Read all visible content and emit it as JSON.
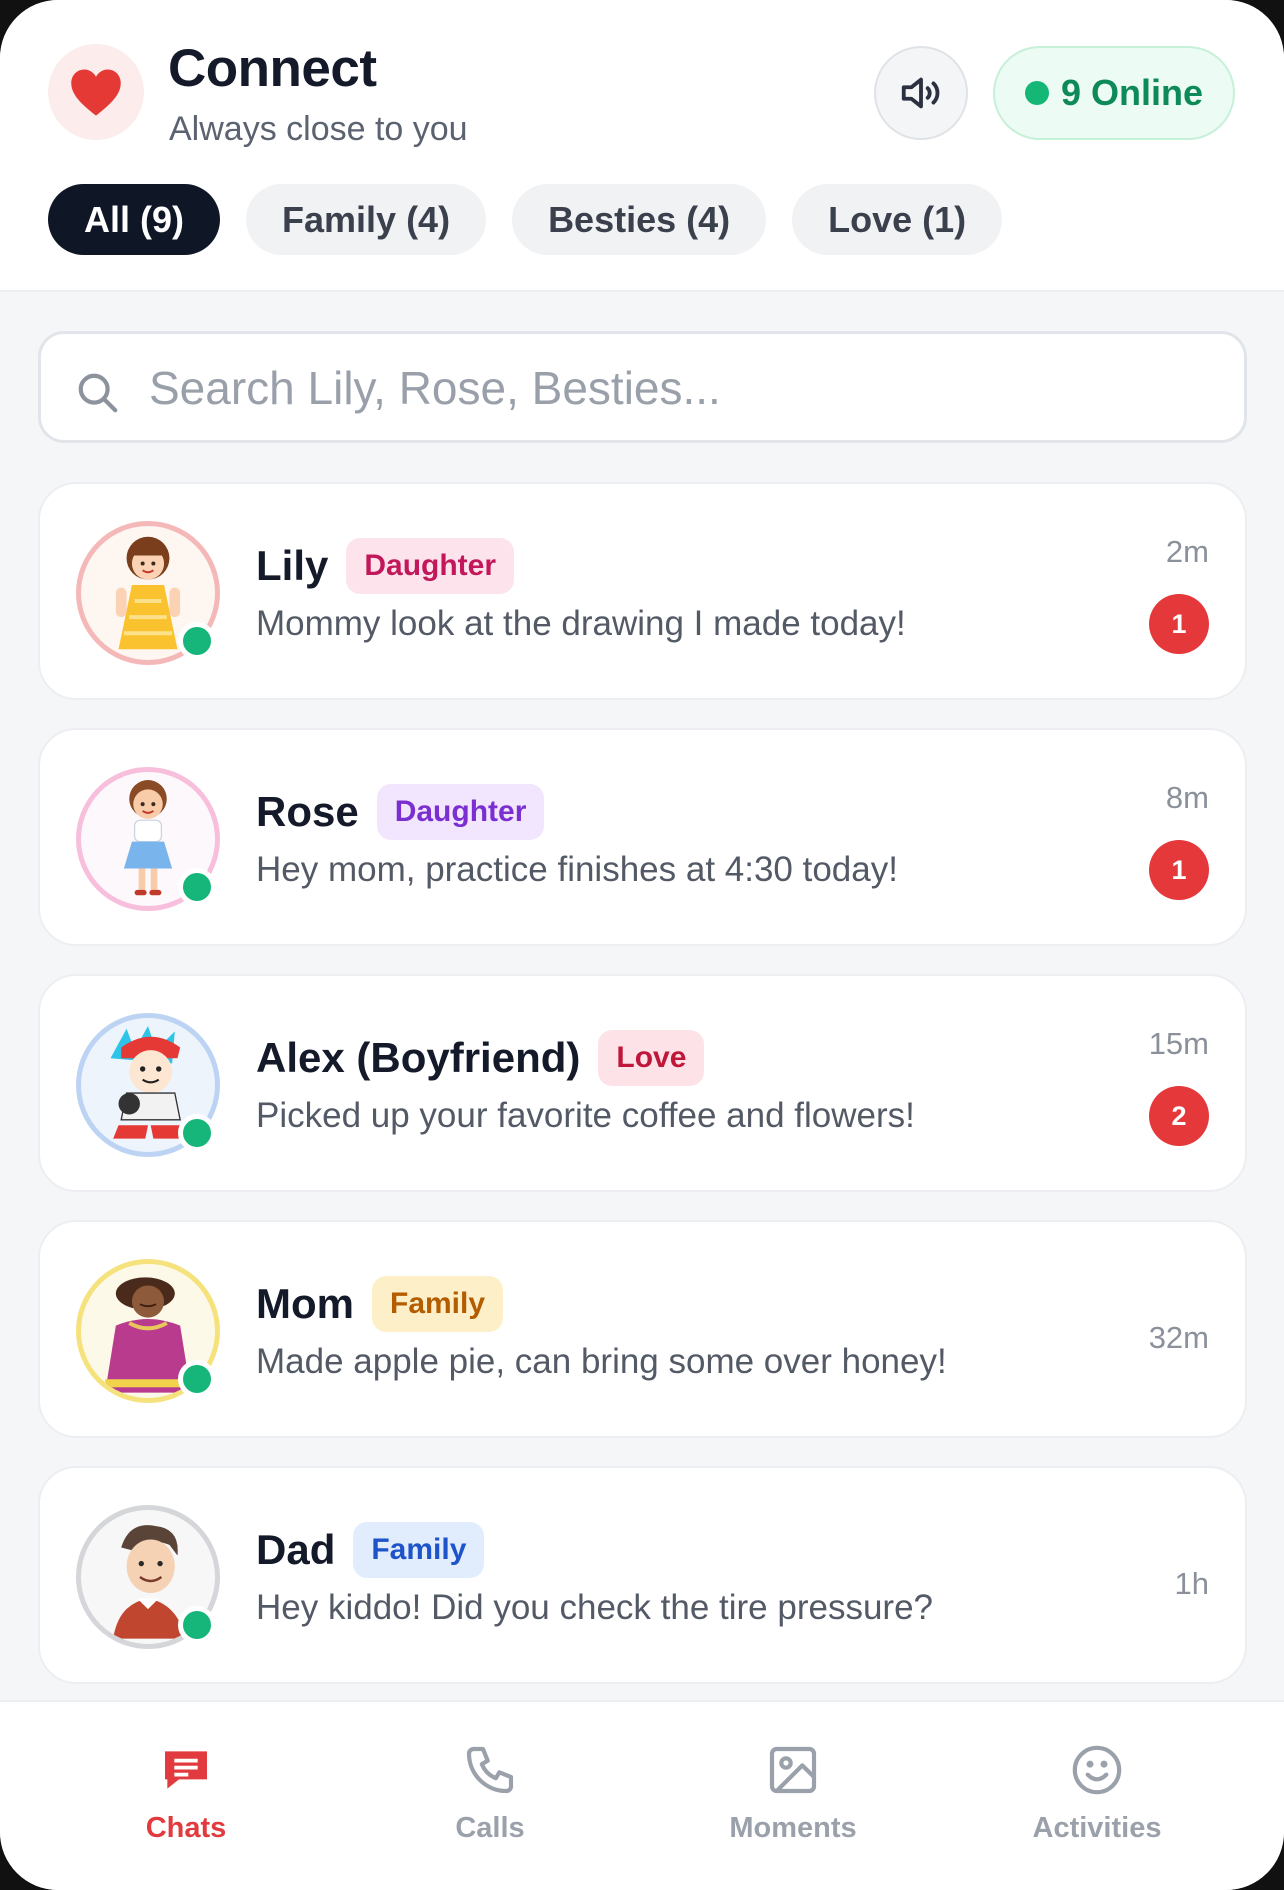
{
  "header": {
    "title": "Connect",
    "subtitle": "Always close to you",
    "online_label": "9 Online",
    "accent_color": "#e53935"
  },
  "filters": [
    {
      "label": "All (9)",
      "active": true
    },
    {
      "label": "Family (4)",
      "active": false
    },
    {
      "label": "Besties (4)",
      "active": false
    },
    {
      "label": "Love (1)",
      "active": false
    }
  ],
  "search": {
    "placeholder": "Search Lily, Rose, Besties...",
    "value": ""
  },
  "chats": [
    {
      "name": "Lily",
      "tag": "Daughter",
      "message": "Mommy look at the drawing I made today!",
      "time": "2m",
      "unread": "1",
      "tag_color": "#c2185b",
      "tag_bg": "#fde4ec",
      "ring": "#f5b8b8",
      "online": true
    },
    {
      "name": "Rose",
      "tag": "Daughter",
      "message": "Hey mom, practice finishes at 4:30 today!",
      "time": "8m",
      "unread": "1",
      "tag_color": "#7b2fd0",
      "tag_bg": "#f1e6fd",
      "ring": "#f7bfdc",
      "online": true
    },
    {
      "name": "Alex (Boyfriend)",
      "tag": "Love",
      "message": "Picked up your favorite coffee and flowers!",
      "time": "15m",
      "unread": "2",
      "tag_color": "#c0163a",
      "tag_bg": "#fde3e7",
      "ring": "#bcd3f4",
      "online": true
    },
    {
      "name": "Mom",
      "tag": "Family",
      "message": "Made apple pie, can bring some over honey!",
      "time": "32m",
      "unread": "",
      "tag_color": "#b35c00",
      "tag_bg": "#fdf0c8",
      "ring": "#f6e27d",
      "online": true
    },
    {
      "name": "Dad",
      "tag": "Family",
      "message": "Hey kiddo! Did you check the tire pressure?",
      "time": "1h",
      "unread": "",
      "tag_color": "#1e54c9",
      "tag_bg": "#e1ecfd",
      "ring": "#d4d6da",
      "online": true
    }
  ],
  "nav": [
    {
      "label": "Chats",
      "icon": "chat-icon",
      "active": true
    },
    {
      "label": "Calls",
      "icon": "phone-icon",
      "active": false
    },
    {
      "label": "Moments",
      "icon": "image-icon",
      "active": false
    },
    {
      "label": "Activities",
      "icon": "smile-icon",
      "active": false
    }
  ]
}
